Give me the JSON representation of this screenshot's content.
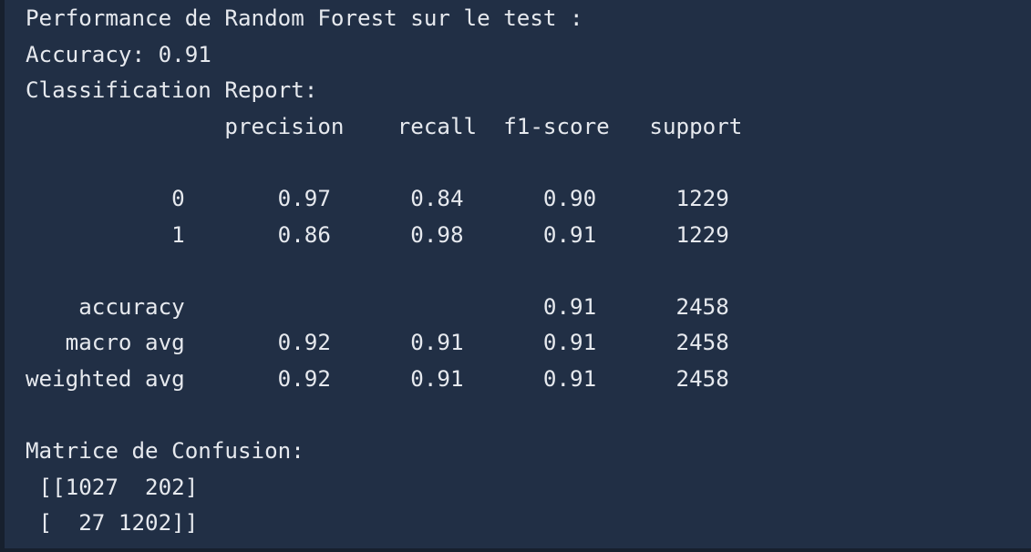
{
  "console": {
    "lines": [
      "Performance de Random Forest sur le test :",
      "Accuracy: 0.91",
      "Classification Report:",
      "               precision    recall  f1-score   support",
      "",
      "           0       0.97      0.84      0.90      1229",
      "           1       0.86      0.98      0.91      1229",
      "",
      "    accuracy                           0.91      2458",
      "   macro avg       0.92      0.91      0.91      2458",
      "weighted avg       0.92      0.91      0.91      2458",
      "",
      "Matrice de Confusion:",
      " [[1027  202]",
      " [  27 1202]]"
    ]
  },
  "colors": {
    "background": "#212f45",
    "text": "#e6e9ee"
  }
}
